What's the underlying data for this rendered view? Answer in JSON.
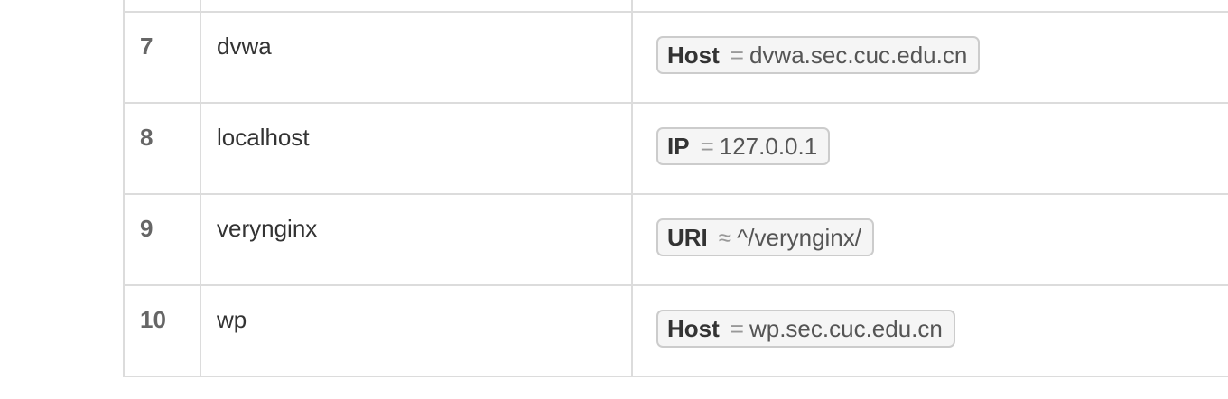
{
  "rows": [
    {
      "num": "7",
      "name": "dvwa",
      "cond": {
        "key": "Host",
        "op": "=",
        "value": "dvwa.sec.cuc.edu.cn"
      }
    },
    {
      "num": "8",
      "name": "localhost",
      "cond": {
        "key": "IP",
        "op": "=",
        "value": "127.0.0.1"
      }
    },
    {
      "num": "9",
      "name": "verynginx",
      "cond": {
        "key": "URI",
        "op": "≈",
        "value": "^/verynginx/"
      }
    },
    {
      "num": "10",
      "name": "wp",
      "cond": {
        "key": "Host",
        "op": "=",
        "value": "wp.sec.cuc.edu.cn"
      }
    }
  ]
}
